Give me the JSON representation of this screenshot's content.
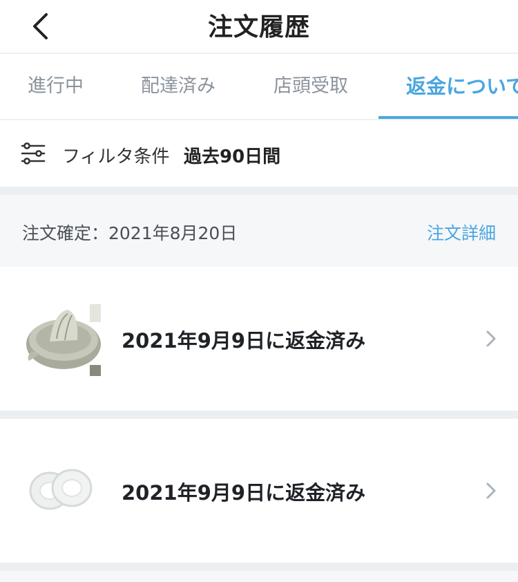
{
  "header": {
    "title": "注文履歴",
    "back_icon": "chevron-left-icon"
  },
  "tabs": [
    {
      "label": "進行中",
      "active": false
    },
    {
      "label": "配達済み",
      "active": false
    },
    {
      "label": "店頭受取",
      "active": false
    },
    {
      "label": "返金について",
      "active": true
    }
  ],
  "filter": {
    "icon": "sliders-icon",
    "label": "フィルタ条件",
    "value": "過去90日間"
  },
  "order": {
    "date": "注文確定：2021年8月20日",
    "detail_link": "注文詳細",
    "items": [
      {
        "status": "2021年9月9日に返金済み",
        "thumb": "juicer-product-image"
      },
      {
        "status": "2021年9月9日に返金済み",
        "thumb": "rubber-rings-product-image"
      }
    ]
  },
  "colors": {
    "accent": "#4aa6e0",
    "gap": "#eceff2",
    "section_bg": "#f5f7f9"
  }
}
